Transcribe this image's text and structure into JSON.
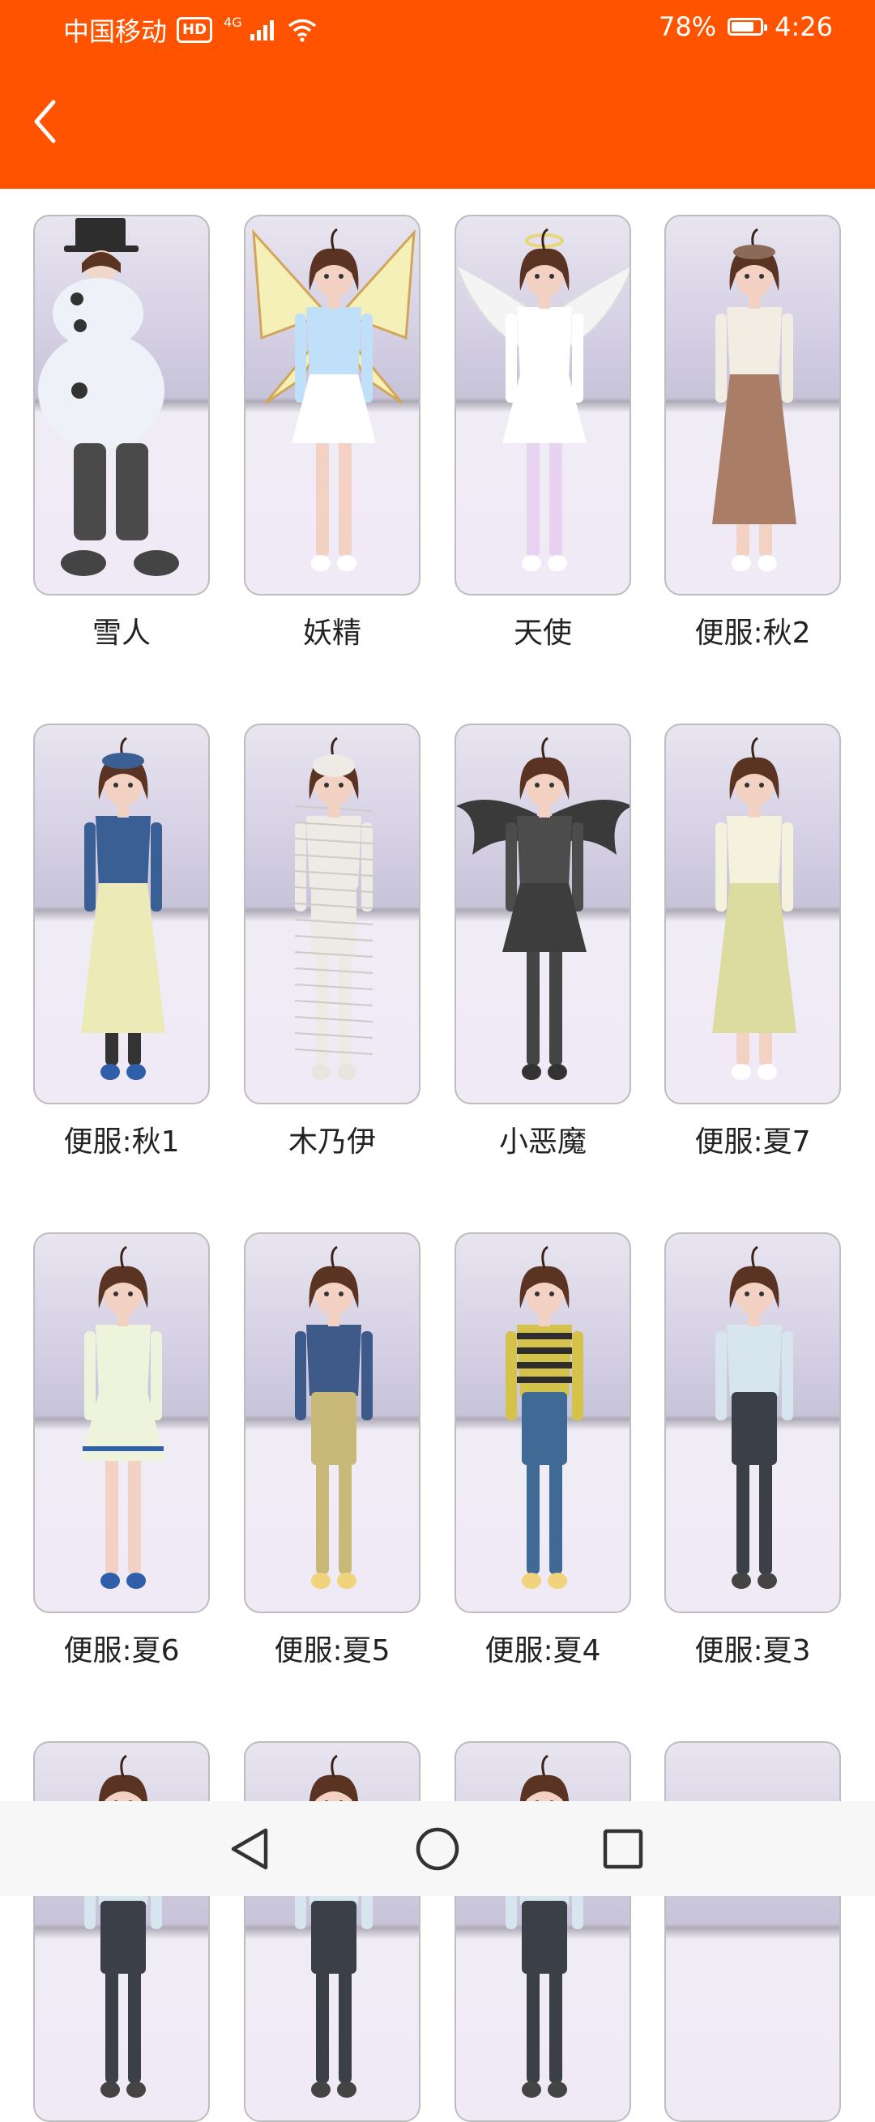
{
  "status_bar": {
    "carrier": "中国移动",
    "hd": "HD",
    "network": "4G",
    "battery_percent": "78%",
    "time": "4:26"
  },
  "header": {
    "back_icon": "chevron-left-icon",
    "color": "#ff5300"
  },
  "costumes": [
    {
      "label": "雪人",
      "kind": "snowman"
    },
    {
      "label": "妖精",
      "kind": "fairy"
    },
    {
      "label": "天使",
      "kind": "angel"
    },
    {
      "label": "便服:秋2",
      "kind": "autumn2"
    },
    {
      "label": "便服:秋1",
      "kind": "autumn1"
    },
    {
      "label": "木乃伊",
      "kind": "mummy"
    },
    {
      "label": "小恶魔",
      "kind": "devil"
    },
    {
      "label": "便服:夏7",
      "kind": "summer7"
    },
    {
      "label": "便服:夏6",
      "kind": "summer6"
    },
    {
      "label": "便服:夏5",
      "kind": "summer5"
    },
    {
      "label": "便服:夏4",
      "kind": "summer4"
    },
    {
      "label": "便服:夏3",
      "kind": "summer3"
    },
    {
      "label": "",
      "kind": "partial"
    },
    {
      "label": "",
      "kind": "partial"
    },
    {
      "label": "",
      "kind": "partial"
    },
    {
      "label": "",
      "kind": "empty"
    }
  ],
  "nav_bar": {
    "back": "triangle-back-icon",
    "home": "circle-home-icon",
    "recents": "square-recents-icon"
  }
}
